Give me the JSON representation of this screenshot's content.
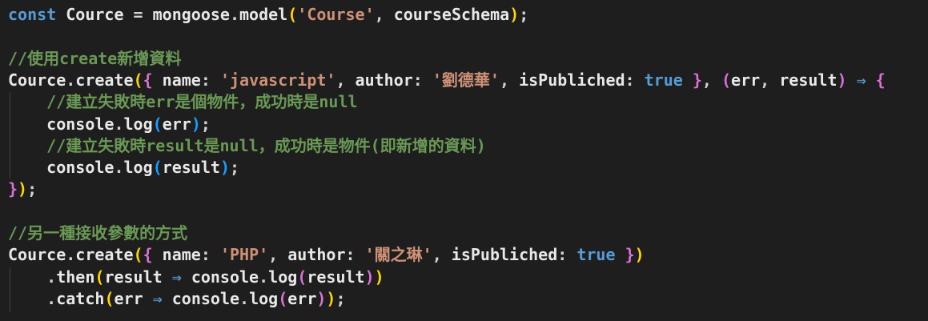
{
  "editor": {
    "background": "#1e1e1e",
    "lines": [
      {
        "tokens": [
          {
            "t": "const",
            "c": "kw"
          },
          {
            "t": " ",
            "c": "var"
          },
          {
            "t": "Cource",
            "c": "var"
          },
          {
            "t": " = ",
            "c": "punct"
          },
          {
            "t": "mongoose",
            "c": "var"
          },
          {
            "t": ".",
            "c": "punct"
          },
          {
            "t": "model",
            "c": "var"
          },
          {
            "t": "(",
            "c": "b1"
          },
          {
            "t": "'Course'",
            "c": "str"
          },
          {
            "t": ", ",
            "c": "punct"
          },
          {
            "t": "courseSchema",
            "c": "var"
          },
          {
            "t": ")",
            "c": "b1"
          },
          {
            "t": ";",
            "c": "punct"
          }
        ]
      },
      {
        "tokens": []
      },
      {
        "tokens": [
          {
            "t": "//使用create新增資料",
            "c": "cmt"
          }
        ]
      },
      {
        "tokens": [
          {
            "t": "Cource",
            "c": "var"
          },
          {
            "t": ".",
            "c": "punct"
          },
          {
            "t": "create",
            "c": "var"
          },
          {
            "t": "(",
            "c": "b1"
          },
          {
            "t": "{",
            "c": "b2"
          },
          {
            "t": " name",
            "c": "var"
          },
          {
            "t": ": ",
            "c": "punct"
          },
          {
            "t": "'javascript'",
            "c": "str"
          },
          {
            "t": ", ",
            "c": "punct"
          },
          {
            "t": "author",
            "c": "var"
          },
          {
            "t": ": ",
            "c": "punct"
          },
          {
            "t": "'劉德華'",
            "c": "str"
          },
          {
            "t": ", ",
            "c": "punct"
          },
          {
            "t": "isPubliched",
            "c": "var"
          },
          {
            "t": ": ",
            "c": "punct"
          },
          {
            "t": "true",
            "c": "bool"
          },
          {
            "t": " ",
            "c": "punct"
          },
          {
            "t": "}",
            "c": "b2"
          },
          {
            "t": ", ",
            "c": "punct"
          },
          {
            "t": "(",
            "c": "b2"
          },
          {
            "t": "err",
            "c": "var"
          },
          {
            "t": ", ",
            "c": "punct"
          },
          {
            "t": "result",
            "c": "var"
          },
          {
            "t": ")",
            "c": "b2"
          },
          {
            "t": " ⇒ ",
            "c": "op"
          },
          {
            "t": "{",
            "c": "b2"
          }
        ]
      },
      {
        "tokens": [
          {
            "t": "    ",
            "c": "punct"
          },
          {
            "t": "//建立失敗時err是個物件，成功時是null",
            "c": "cmt"
          }
        ]
      },
      {
        "tokens": [
          {
            "t": "    ",
            "c": "punct"
          },
          {
            "t": "console",
            "c": "var"
          },
          {
            "t": ".",
            "c": "punct"
          },
          {
            "t": "log",
            "c": "var"
          },
          {
            "t": "(",
            "c": "b3"
          },
          {
            "t": "err",
            "c": "var"
          },
          {
            "t": ")",
            "c": "b3"
          },
          {
            "t": ";",
            "c": "punct"
          }
        ]
      },
      {
        "tokens": [
          {
            "t": "    ",
            "c": "punct"
          },
          {
            "t": "//建立失敗時result是null，成功時是物件(即新增的資料)",
            "c": "cmt"
          }
        ]
      },
      {
        "tokens": [
          {
            "t": "    ",
            "c": "punct"
          },
          {
            "t": "console",
            "c": "var"
          },
          {
            "t": ".",
            "c": "punct"
          },
          {
            "t": "log",
            "c": "var"
          },
          {
            "t": "(",
            "c": "b3"
          },
          {
            "t": "result",
            "c": "var"
          },
          {
            "t": ")",
            "c": "b3"
          },
          {
            "t": ";",
            "c": "punct"
          }
        ]
      },
      {
        "tokens": [
          {
            "t": "}",
            "c": "b2"
          },
          {
            "t": ")",
            "c": "b1"
          },
          {
            "t": ";",
            "c": "punct"
          }
        ]
      },
      {
        "tokens": []
      },
      {
        "tokens": [
          {
            "t": "//另一種接收參數的方式",
            "c": "cmt"
          }
        ]
      },
      {
        "tokens": [
          {
            "t": "Cource",
            "c": "var"
          },
          {
            "t": ".",
            "c": "punct"
          },
          {
            "t": "create",
            "c": "var"
          },
          {
            "t": "(",
            "c": "b1"
          },
          {
            "t": "{",
            "c": "b2"
          },
          {
            "t": " name",
            "c": "var"
          },
          {
            "t": ": ",
            "c": "punct"
          },
          {
            "t": "'PHP'",
            "c": "str"
          },
          {
            "t": ", ",
            "c": "punct"
          },
          {
            "t": "author",
            "c": "var"
          },
          {
            "t": ": ",
            "c": "punct"
          },
          {
            "t": "'關之琳'",
            "c": "str"
          },
          {
            "t": ", ",
            "c": "punct"
          },
          {
            "t": "isPubliched",
            "c": "var"
          },
          {
            "t": ": ",
            "c": "punct"
          },
          {
            "t": "true",
            "c": "bool"
          },
          {
            "t": " ",
            "c": "punct"
          },
          {
            "t": "}",
            "c": "b2"
          },
          {
            "t": ")",
            "c": "b1"
          }
        ]
      },
      {
        "tokens": [
          {
            "t": "    ",
            "c": "punct"
          },
          {
            "t": ".",
            "c": "punct"
          },
          {
            "t": "then",
            "c": "var"
          },
          {
            "t": "(",
            "c": "b1"
          },
          {
            "t": "result",
            "c": "var"
          },
          {
            "t": " ⇒ ",
            "c": "op"
          },
          {
            "t": "console",
            "c": "var"
          },
          {
            "t": ".",
            "c": "punct"
          },
          {
            "t": "log",
            "c": "var"
          },
          {
            "t": "(",
            "c": "b2"
          },
          {
            "t": "result",
            "c": "var"
          },
          {
            "t": ")",
            "c": "b2"
          },
          {
            "t": ")",
            "c": "b1"
          }
        ]
      },
      {
        "tokens": [
          {
            "t": "    ",
            "c": "punct"
          },
          {
            "t": ".",
            "c": "punct"
          },
          {
            "t": "catch",
            "c": "var"
          },
          {
            "t": "(",
            "c": "b1"
          },
          {
            "t": "err",
            "c": "var"
          },
          {
            "t": " ⇒ ",
            "c": "op"
          },
          {
            "t": "console",
            "c": "var"
          },
          {
            "t": ".",
            "c": "punct"
          },
          {
            "t": "log",
            "c": "var"
          },
          {
            "t": "(",
            "c": "b2"
          },
          {
            "t": "err",
            "c": "var"
          },
          {
            "t": ")",
            "c": "b2"
          },
          {
            "t": ")",
            "c": "b1"
          },
          {
            "t": ";",
            "c": "punct"
          }
        ]
      }
    ]
  }
}
